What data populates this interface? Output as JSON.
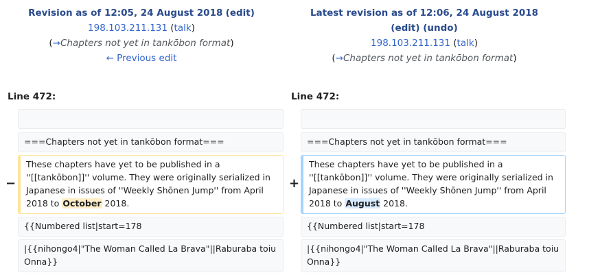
{
  "left": {
    "title_prefix": "Revision as of 12:05, 24 August 2018",
    "edit_label": "edit",
    "user": "198.103.211.131",
    "talk_label": "talk",
    "summary_arrow": "→",
    "summary_text": "Chapters not yet in tankōbon format",
    "prev_edit_label": "← Previous edit",
    "line_number": "Line 472:"
  },
  "right": {
    "title": "Latest revision as of 12:06, 24 August 2018",
    "edit_label": "edit",
    "undo_label": "undo",
    "user": "198.103.211.131",
    "talk_label": "talk",
    "summary_arrow": "→",
    "summary_text": "Chapters not yet in tankōbon format",
    "line_number": "Line 472:"
  },
  "diff": {
    "heading_line": "===Chapters not yet in tankōbon format===",
    "removed_marker": "−",
    "added_marker": "+",
    "changed_before": "These chapters have yet to be published in a ''[[tankōbon]]'' volume. They were originally serialized in Japanese in issues of ''Weekly Shōnen Jump'' from April 2018 to",
    "changed_after": "2018.",
    "removed_word": "October",
    "added_word": "August",
    "numbered_list_line": "{{Numbered list|start=178",
    "nihongo_line": "|{{nihongo4|\"The Woman Called La Brava\"||Raburaba toiu Onna}}"
  }
}
